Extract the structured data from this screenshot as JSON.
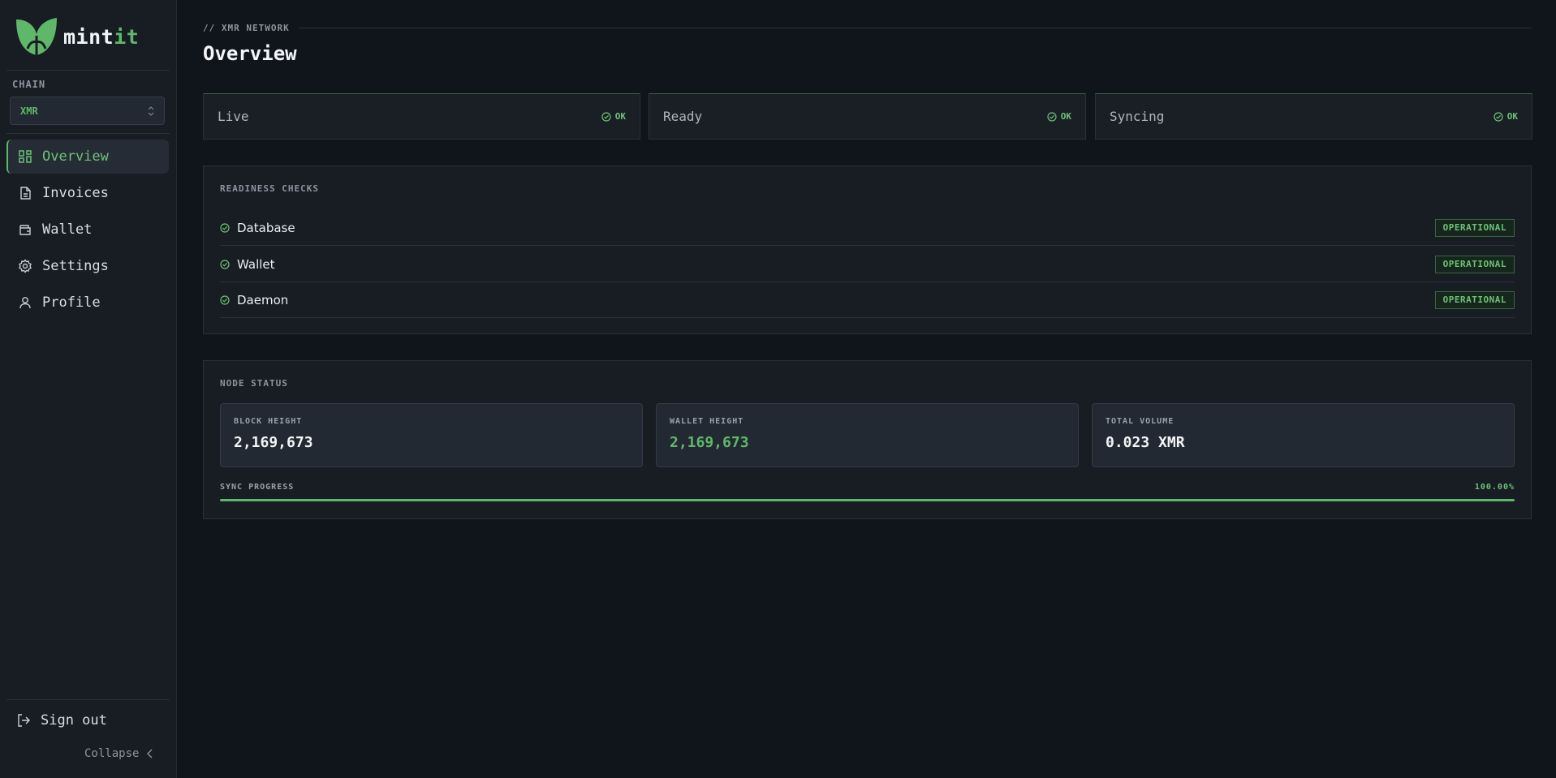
{
  "brand": {
    "name_part1": "mint",
    "name_part2": "it",
    "accent": "#5fb86a"
  },
  "sidebar": {
    "chain_label": "CHAIN",
    "chain_value": "XMR",
    "nav": [
      {
        "label": "Overview",
        "icon": "grid-icon",
        "active": true
      },
      {
        "label": "Invoices",
        "icon": "file-icon",
        "active": false
      },
      {
        "label": "Wallet",
        "icon": "wallet-icon",
        "active": false
      },
      {
        "label": "Settings",
        "icon": "gear-icon",
        "active": false
      },
      {
        "label": "Profile",
        "icon": "user-icon",
        "active": false
      }
    ],
    "sign_out": "Sign out",
    "collapse": "Collapse"
  },
  "header": {
    "breadcrumb": "// XMR NETWORK",
    "title": "Overview"
  },
  "status_cards": [
    {
      "label": "Live",
      "status": "OK"
    },
    {
      "label": "Ready",
      "status": "OK"
    },
    {
      "label": "Syncing",
      "status": "OK"
    }
  ],
  "readiness": {
    "title": "READINESS CHECKS",
    "checks": [
      {
        "name": "Database",
        "status": "OPERATIONAL"
      },
      {
        "name": "Wallet",
        "status": "OPERATIONAL"
      },
      {
        "name": "Daemon",
        "status": "OPERATIONAL"
      }
    ]
  },
  "node_status": {
    "title": "NODE STATUS",
    "metrics": [
      {
        "label": "BLOCK HEIGHT",
        "value": "2,169,673"
      },
      {
        "label": "WALLET HEIGHT",
        "value": "2,169,673"
      },
      {
        "label": "TOTAL VOLUME",
        "value": "0.023 XMR"
      }
    ],
    "sync_label": "SYNC PROGRESS",
    "sync_percent_text": "100.00%",
    "sync_fraction": 1.0
  }
}
